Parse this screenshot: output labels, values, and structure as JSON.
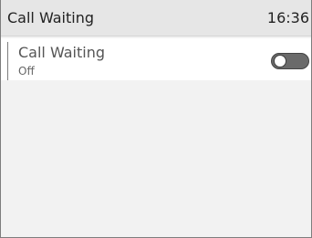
{
  "header": {
    "title": "Call Waiting",
    "time": "16:36"
  },
  "settings": {
    "call_waiting": {
      "label": "Call Waiting",
      "value": "Off",
      "enabled": false
    }
  },
  "colors": {
    "header_background": "#e6e6e6",
    "row_background": "#ffffff",
    "page_background": "#f2f2f2",
    "toggle_off": "#6a6a6a"
  },
  "icons": {
    "toggle": "toggle-switch-off"
  }
}
